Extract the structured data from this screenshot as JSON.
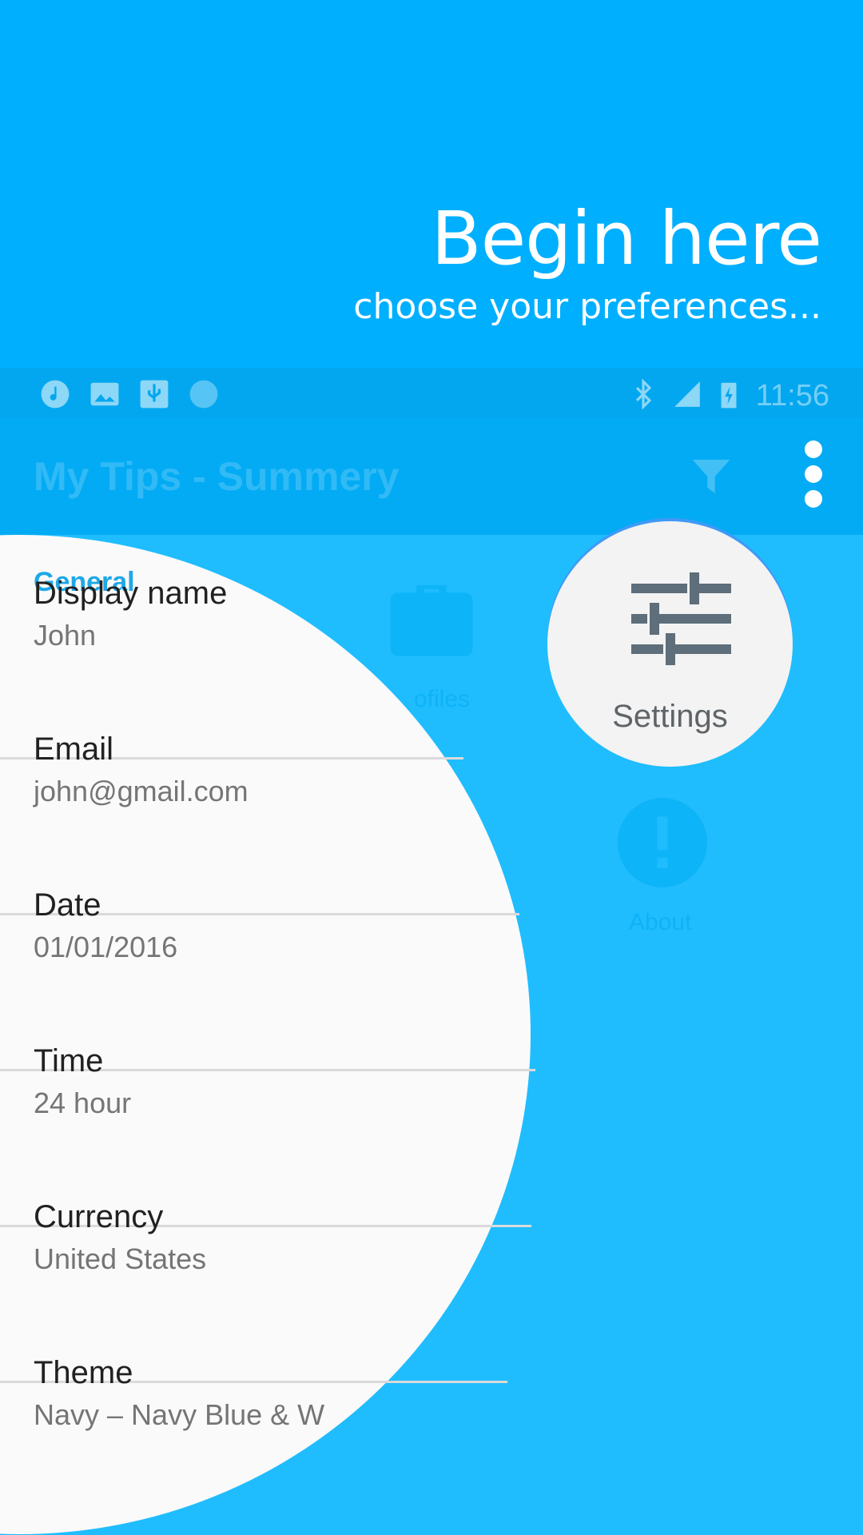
{
  "intro": {
    "title": "Begin here",
    "subtitle": "choose your preferences..."
  },
  "status_bar": {
    "time": "11:56",
    "icons": [
      "music-icon",
      "image-icon",
      "usb-icon",
      "circle-icon",
      "bluetooth-icon",
      "signal-icon",
      "battery-charging-icon"
    ]
  },
  "app_bar": {
    "title": "My Tips - Summery",
    "actions": [
      "filter-icon",
      "overflow-menu-icon"
    ]
  },
  "background_tiles": {
    "profiles_label": "ofiles",
    "about_label": "About"
  },
  "settings_button": {
    "label": "Settings",
    "icon": "tune-sliders-icon"
  },
  "preferences": {
    "section": "General",
    "items": [
      {
        "title": "Display name",
        "summary": "John"
      },
      {
        "title": "Email",
        "summary": "john@gmail.com"
      },
      {
        "title": "Date",
        "summary": "01/01/2016"
      },
      {
        "title": "Time",
        "summary": "24 hour"
      },
      {
        "title": "Currency",
        "summary": "United States"
      },
      {
        "title": "Theme",
        "summary": "Navy – Navy Blue & W"
      }
    ]
  },
  "colors": {
    "hero": "#00AFFE",
    "background": "#1FBDFE",
    "accent": "#1EA8E7",
    "panel": "#FAFAFA"
  }
}
